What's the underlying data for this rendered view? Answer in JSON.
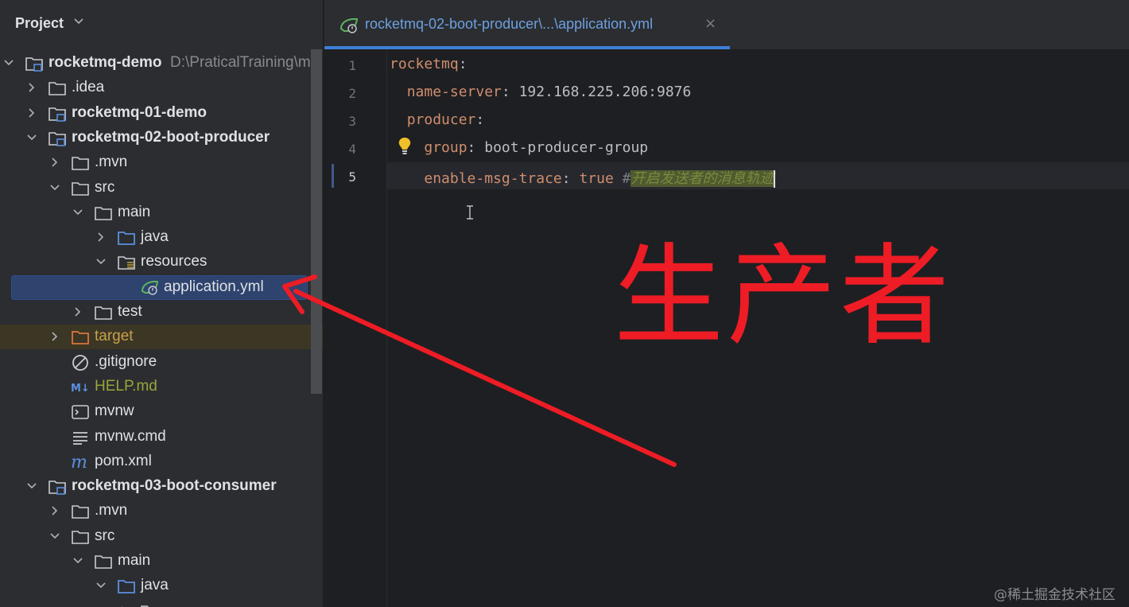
{
  "project_panel": {
    "title": "Project",
    "tree": [
      {
        "label": "rocketmq-demo",
        "hint": "D:\\PraticalTraining\\my",
        "depth": 0,
        "expanded": true,
        "type": "module",
        "bold": true,
        "name": "rocketmq-demo"
      },
      {
        "label": ".idea",
        "depth": 1,
        "expanded": false,
        "type": "folder",
        "name": "idea"
      },
      {
        "label": "rocketmq-01-demo",
        "depth": 1,
        "expanded": false,
        "type": "module",
        "bold": true,
        "name": "rocketmq-01-demo"
      },
      {
        "label": "rocketmq-02-boot-producer",
        "depth": 1,
        "expanded": true,
        "type": "module",
        "bold": true,
        "name": "rocketmq-02-boot-producer"
      },
      {
        "label": ".mvn",
        "depth": 2,
        "expanded": false,
        "type": "folder",
        "name": "mvn"
      },
      {
        "label": "src",
        "depth": 2,
        "expanded": true,
        "type": "folder",
        "name": "src"
      },
      {
        "label": "main",
        "depth": 3,
        "expanded": true,
        "type": "folder",
        "name": "main"
      },
      {
        "label": "java",
        "depth": 4,
        "expanded": false,
        "type": "source-folder",
        "name": "java"
      },
      {
        "label": "resources",
        "depth": 4,
        "expanded": true,
        "type": "resources-folder",
        "name": "resources"
      },
      {
        "label": "application.yml",
        "depth": 5,
        "type": "spring-yml",
        "selected": true,
        "name": "application-yml"
      },
      {
        "label": "test",
        "depth": 3,
        "expanded": false,
        "type": "folder",
        "name": "test"
      },
      {
        "label": "target",
        "depth": 2,
        "expanded": false,
        "type": "excluded-folder",
        "excluded": true,
        "name": "target"
      },
      {
        "label": ".gitignore",
        "depth": 2,
        "type": "ignore-file",
        "name": "gitignore"
      },
      {
        "label": "HELP.md",
        "depth": 2,
        "type": "markdown",
        "md": true,
        "name": "help-md"
      },
      {
        "label": "mvnw",
        "depth": 2,
        "type": "shell",
        "name": "mvnw"
      },
      {
        "label": "mvnw.cmd",
        "depth": 2,
        "type": "text",
        "name": "mvnw-cmd"
      },
      {
        "label": "pom.xml",
        "depth": 2,
        "type": "maven",
        "name": "pom-xml"
      },
      {
        "label": "rocketmq-03-boot-consumer",
        "depth": 1,
        "expanded": true,
        "type": "module",
        "bold": true,
        "name": "rocketmq-03-boot-consumer"
      },
      {
        "label": ".mvn",
        "depth": 2,
        "expanded": false,
        "type": "folder",
        "name": "mvn-2"
      },
      {
        "label": "src",
        "depth": 2,
        "expanded": true,
        "type": "folder",
        "name": "src-2"
      },
      {
        "label": "main",
        "depth": 3,
        "expanded": true,
        "type": "folder",
        "name": "main-2"
      },
      {
        "label": "java",
        "depth": 4,
        "expanded": true,
        "type": "source-folder",
        "name": "java-2"
      },
      {
        "label": "",
        "depth": 5,
        "expanded": false,
        "type": "folder",
        "name": "partial-folder"
      }
    ]
  },
  "editor": {
    "tab_label": "rocketmq-02-boot-producer\\...\\application.yml",
    "tab_close": "×",
    "line_numbers": [
      "1",
      "2",
      "3",
      "4",
      "5"
    ],
    "current_line": "5",
    "lines": {
      "l1_key": "rocketmq",
      "l2_key": "name-server",
      "l2_val": "192.168.225.206:9876",
      "l3_key": "producer",
      "l4_key": "group",
      "l4_val": "boot-producer-group",
      "l5_key": "enable-msg-trace",
      "l5_val": "true",
      "l5_hash": "#",
      "l5_comment": "开启发送者的消息轨迹"
    },
    "colon": ":"
  },
  "annotation": {
    "text": "生产者",
    "color": "#ee1c25"
  },
  "watermark": "@稀土掘金技术社区",
  "colors": {
    "accent": "#3d7fd6",
    "selection": "#2e436e",
    "yaml_key": "#cf8e6d"
  }
}
